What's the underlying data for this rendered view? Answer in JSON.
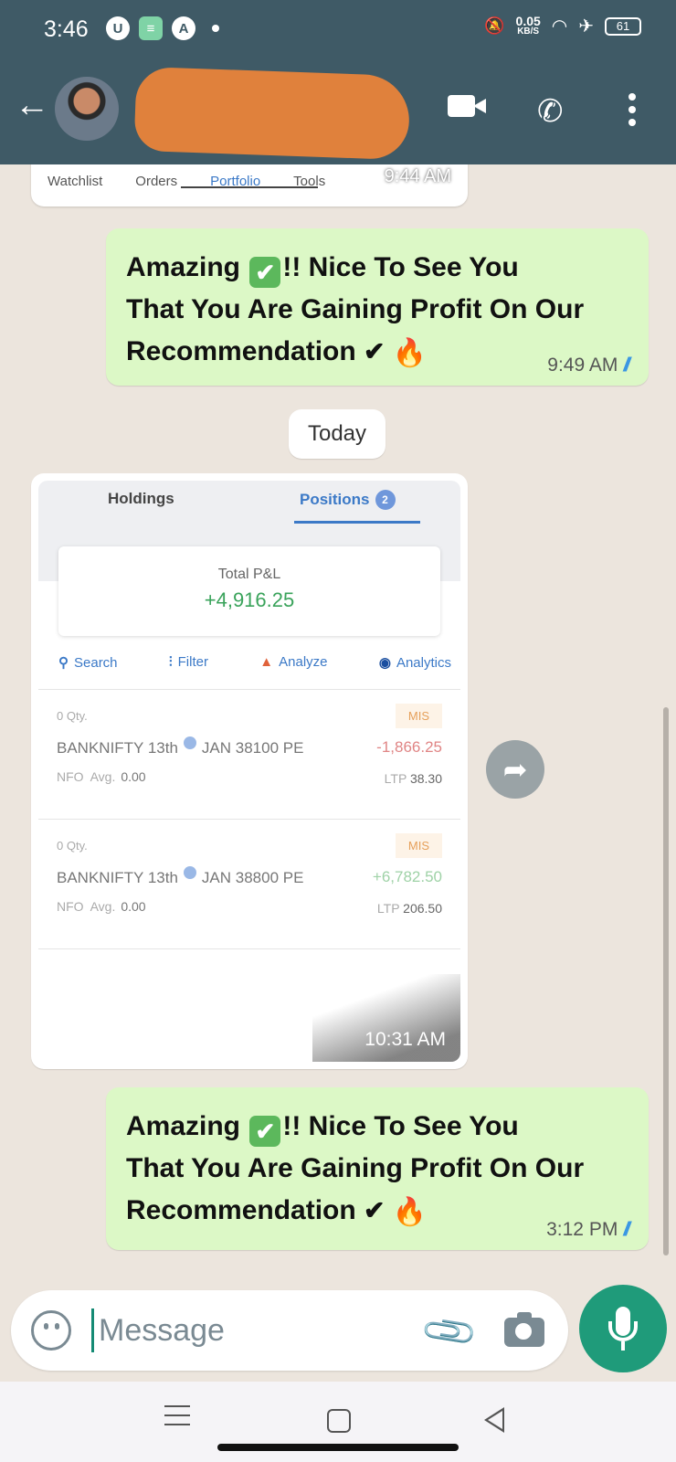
{
  "status_bar": {
    "time": "3:46",
    "speed_value": "0.05",
    "speed_unit": "KB/S",
    "battery": "61"
  },
  "header": {
    "icons": [
      "back-arrow-icon",
      "avatar",
      "video-call-icon",
      "voice-call-icon",
      "more-vert-icon"
    ]
  },
  "chat": {
    "partial_image": {
      "tabs": [
        "Watchlist",
        "Orders",
        "Portfolio",
        "Tools"
      ],
      "time": "9:44 AM"
    },
    "message1": {
      "line1_a": "Amazing ",
      "line1_b": "!! Nice   To See You",
      "line2": "That You Are Gaining Profit On  Our",
      "line3": "Recommendation ",
      "check_glyph": "✔",
      "tick_glyph": "✔",
      "fire_glyph": "🔥",
      "time": "9:49 AM"
    },
    "date_chip": "Today",
    "image_message": {
      "tab_holdings": "Holdings",
      "tab_positions": "Positions",
      "positions_count": "2",
      "total_pnl_label": "Total P&L",
      "total_pnl_value": "+4,916.25",
      "tools": {
        "search": "Search",
        "filter": "Filter",
        "analyze": "Analyze",
        "analytics": "Analytics"
      },
      "positions": [
        {
          "qty": "0 Qty.",
          "name_a": "BANKNIFTY 13th",
          "name_b": "JAN 38100 PE",
          "exchange": "NFO",
          "avg_label": "Avg.",
          "avg": "0.00",
          "product": "MIS",
          "pnl": "-1,866.25",
          "ltp_label": "LTP",
          "ltp": "38.30"
        },
        {
          "qty": "0 Qty.",
          "name_a": "BANKNIFTY 13th",
          "name_b": "JAN 38800 PE",
          "exchange": "NFO",
          "avg_label": "Avg.",
          "avg": "0.00",
          "product": "MIS",
          "pnl": "+6,782.50",
          "ltp_label": "LTP",
          "ltp": "206.50"
        }
      ],
      "time": "10:31 AM"
    },
    "message2": {
      "line1_a": "Amazing ",
      "line1_b": "!! Nice   To See You",
      "line2": "That You Are Gaining Profit On  Our",
      "line3": "Recommendation ",
      "check_glyph": "✔",
      "tick_glyph": "✔",
      "fire_glyph": "🔥",
      "time": "3:12 PM"
    },
    "read_receipt": "//",
    "forward_glyph": "➦"
  },
  "input": {
    "placeholder": "Message"
  },
  "colors": {
    "header": "#3f5a66",
    "outgoing_bubble": "#dcf8c6",
    "chat_background": "#ece5dd",
    "accent_green": "#1f9b7a",
    "profit_green": "#3aa35b"
  }
}
